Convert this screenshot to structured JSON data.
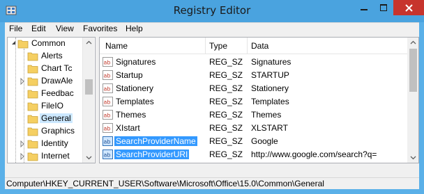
{
  "window": {
    "title": "Registry Editor"
  },
  "menu": [
    "File",
    "Edit",
    "View",
    "Favorites",
    "Help"
  ],
  "tree": {
    "items": [
      {
        "label": "Common",
        "expanded": true
      },
      {
        "label": "Alerts"
      },
      {
        "label": "Chart Tc"
      },
      {
        "label": "DrawAle"
      },
      {
        "label": "Feedbac"
      },
      {
        "label": "FileIO"
      },
      {
        "label": "General",
        "selected": true
      },
      {
        "label": "Graphics"
      },
      {
        "label": "Identity"
      },
      {
        "label": "Internet"
      }
    ]
  },
  "list": {
    "columns": [
      "Name",
      "Type",
      "Data"
    ],
    "rows": [
      {
        "name": "Signatures",
        "type": "REG_SZ",
        "data": "Signatures"
      },
      {
        "name": "Startup",
        "type": "REG_SZ",
        "data": "STARTUP"
      },
      {
        "name": "Stationery",
        "type": "REG_SZ",
        "data": "Stationery"
      },
      {
        "name": "Templates",
        "type": "REG_SZ",
        "data": "Templates"
      },
      {
        "name": "Themes",
        "type": "REG_SZ",
        "data": "Themes"
      },
      {
        "name": "XIstart",
        "type": "REG_SZ",
        "data": "XLSTART"
      },
      {
        "name": "SearchProviderName",
        "type": "REG_SZ",
        "data": "Google",
        "selected": true
      },
      {
        "name": "SearchProviderURI",
        "type": "REG_SZ",
        "data": "http://www.google.com/search?q=",
        "selected": true
      }
    ]
  },
  "status": {
    "path": "Computer\\HKEY_CURRENT_USER\\Software\\Microsoft\\Office\\15.0\\Common\\General"
  },
  "colors": {
    "titlebar": "#4aa3df",
    "close_button": "#c7342d",
    "selection": "#3399ff",
    "tree_selection": "#cce8ff"
  }
}
